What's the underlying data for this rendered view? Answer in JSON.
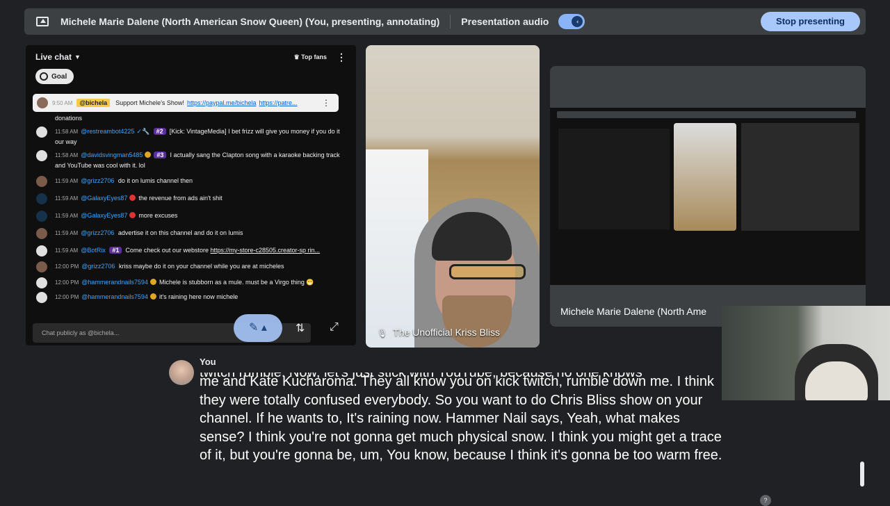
{
  "topbar": {
    "title": "Michele Marie Dalene (North American Snow Queen) (You, presenting, annotating)",
    "audio_label": "Presentation audio",
    "stop_label": "Stop presenting"
  },
  "chat": {
    "header": "Live chat",
    "top_fans": "Top fans",
    "goal": "Goal",
    "pinned": {
      "time": "9:50 AM",
      "user": "@bichela",
      "text": "Support Michele's Show!",
      "link1": "https://paypal.me/bichela",
      "link2": "https://patre..."
    },
    "messages": [
      {
        "time": "",
        "user": "",
        "text": "donations"
      },
      {
        "time": "11:58 AM",
        "user": "@restreambot4225",
        "rank": "#2",
        "text": "[Kick: VintageMedia] I bet frizz will give you money if you do it our way"
      },
      {
        "time": "11:58 AM",
        "user": "@davidsvingman5485",
        "rank": "#3",
        "text": "I actually sang the Clapton song with a karaoke backing track and YouTube was cool with it. lol"
      },
      {
        "time": "11:59 AM",
        "user": "@grizz2706",
        "text": "do it on lumis channel then"
      },
      {
        "time": "11:59 AM",
        "user": "@GalaxyEyes87",
        "text": "the revenue from ads ain't shit"
      },
      {
        "time": "11:59 AM",
        "user": "@GalaxyEyes87",
        "text": "more excuses"
      },
      {
        "time": "11:59 AM",
        "user": "@grizz2706",
        "text": "advertise it on this channel and do it on lumis"
      },
      {
        "time": "11:59 AM",
        "user": "@BotRix",
        "rank": "#1",
        "text": "Come check out our webstore",
        "link": "https://my-store-c28505.creator-sp rin..."
      },
      {
        "time": "12:00 PM",
        "user": "@grizz2706",
        "text": "kriss maybe do it on your channel while you are at micheles"
      },
      {
        "time": "12:00 PM",
        "user": "@hammerandnails7594",
        "text": "Michele is stubborn as a mule. must be a Virgo thing 😁"
      },
      {
        "time": "12:00 PM",
        "user": "@hammerandnails7594",
        "text": "it's raining here now michele"
      }
    ],
    "input_placeholder": "Chat publicly as @bichela..."
  },
  "participant_tile": {
    "name": "The Unofficial Kriss Bliss"
  },
  "share_tile": {
    "name": "Michele Marie Dalene (North Ame"
  },
  "captions": {
    "speaker": "You",
    "cut_line": "twitch rumble. Now, let's just stick with YouTube, because no one knows",
    "text": "me and Kate Kucharoma. They all know you on kick twitch, rumble down me. I think they were totally confused everybody. So you want to do Chris Bliss show on your channel. If he wants to, It's raining now. Hammer Nail says, Yeah, what makes sense? I think you're not gonna get much physical snow. I think you might get a trace of it, but you're gonna be, um, You know, because I think it's gonna be too warm free."
  },
  "colors": {
    "accent": "#a8c7fa",
    "background": "#202124",
    "link": "#3ea6ff"
  }
}
